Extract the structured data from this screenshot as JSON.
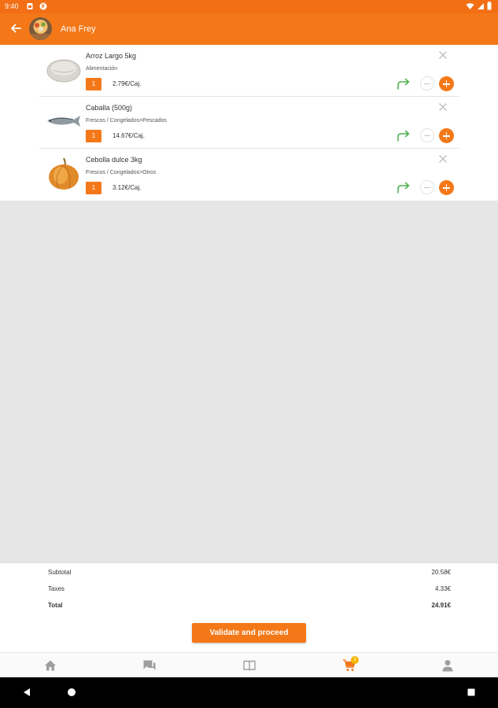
{
  "status_bar": {
    "time": "9:40",
    "icons": [
      "sim-card-icon",
      "app-notification-icon",
      "wifi-icon",
      "signal-icon",
      "battery-icon"
    ]
  },
  "app_bar": {
    "title": "Ana Frey",
    "icons": [
      "back-arrow-icon",
      "avatar-icon"
    ]
  },
  "cart": {
    "items": [
      {
        "name": "Arroz Largo 5kg",
        "category": "Alimentación",
        "quantity": "1",
        "price": "2.79€/Caj.",
        "image": "rice-bag-icon"
      },
      {
        "name": "Caballa (500g)",
        "category": "Frescos / Congelados>Pescados",
        "quantity": "1",
        "price": "14.67€/Caj.",
        "image": "mackerel-fish-icon"
      },
      {
        "name": "Cebolla dulce 3kg",
        "category": "Frescos / Congelados>Otros",
        "quantity": "1",
        "price": "3.12€/Caj.",
        "image": "onion-icon"
      }
    ]
  },
  "summary": {
    "subtotal_label": "Subtotal",
    "subtotal_value": "20.58€",
    "taxes_label": "Taxes",
    "taxes_value": "4.33€",
    "total_label": "Total",
    "total_value": "24.91€",
    "validate_label": "Validate and proceed"
  },
  "bottom_nav": {
    "cart_badge": "3",
    "items": [
      "home-icon",
      "chat-icon",
      "catalog-book-icon",
      "cart-icon",
      "profile-icon"
    ],
    "active": "cart-icon"
  },
  "colors": {
    "accent": "#f47818",
    "status_bar": "#f26f15",
    "move_arrow": "#4caf50",
    "badge": "#f7b500"
  }
}
